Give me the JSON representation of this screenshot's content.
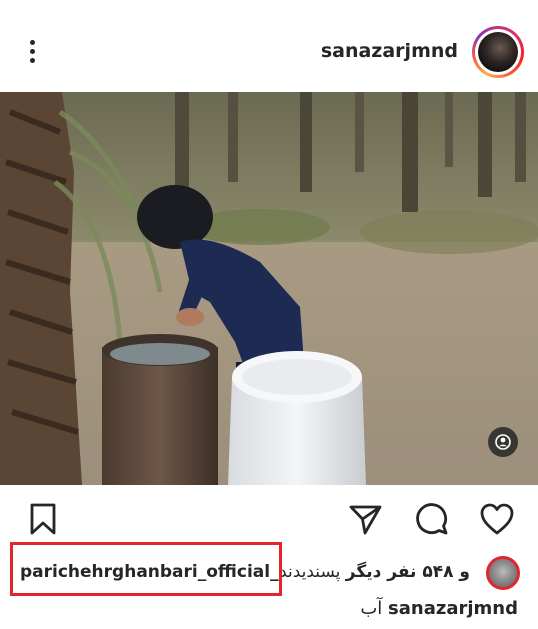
{
  "post": {
    "username": "sanazarjmnd",
    "likes_prefix": "و ۵۴۸ نفر دیگر",
    "likes_suffix": "پسندیدند",
    "liker_username": "parichehrghanbari_official_",
    "caption_user": "sanazarjmnd",
    "caption_text": "آب"
  },
  "icons": {
    "more": "more-vertical-icon",
    "tag": "user-tag-icon",
    "save": "bookmark-icon",
    "share": "send-icon",
    "comment": "comment-icon",
    "like": "heart-icon"
  },
  "colors": {
    "highlight_box": "#e2262e",
    "text": "#262626"
  }
}
